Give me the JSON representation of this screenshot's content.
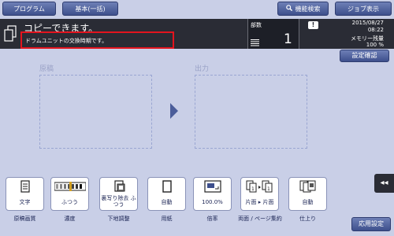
{
  "top_tabs": {
    "program": "プログラム",
    "basic": "基本(一括)",
    "function_search": "機能検索",
    "job_display": "ジョブ表示"
  },
  "status": {
    "main": "コピーできます。",
    "sub": "ドラムユニットの交換時期です。"
  },
  "copies": {
    "label": "部数",
    "value": "1"
  },
  "info": {
    "date": "2015/08/27",
    "time": "08:22",
    "memory_label": "メモリー残量",
    "memory_value": "100 %"
  },
  "confirm_settings": "設定確認",
  "panes": {
    "original": "原稿",
    "output": "出力"
  },
  "function_keys": [
    {
      "value": "文字",
      "label": "原稿画質",
      "icon": "document-icon"
    },
    {
      "value": "ふつう",
      "label": "濃度",
      "icon": "density-scale-icon"
    },
    {
      "value": "裏写り除去 ふつう",
      "label": "下地調整",
      "icon": "background-removal-icon"
    },
    {
      "value": "自動",
      "label": "用紙",
      "icon": "paper-icon"
    },
    {
      "value": "100.0%",
      "label": "倍率",
      "icon": "zoom-icon"
    },
    {
      "value": "片面 ▸ 片面",
      "label": "両面 / ページ集約",
      "icon": "duplex-icon"
    },
    {
      "value": "自動",
      "label": "仕上り",
      "icon": "finishing-icon"
    }
  ],
  "side_tab": "◂◂",
  "apply_settings": "応用設定",
  "colors": {
    "background": "#c9cfe7",
    "header": "#2a2c35",
    "button_blue": "#3d4f8c",
    "highlight": "#e3141e"
  }
}
